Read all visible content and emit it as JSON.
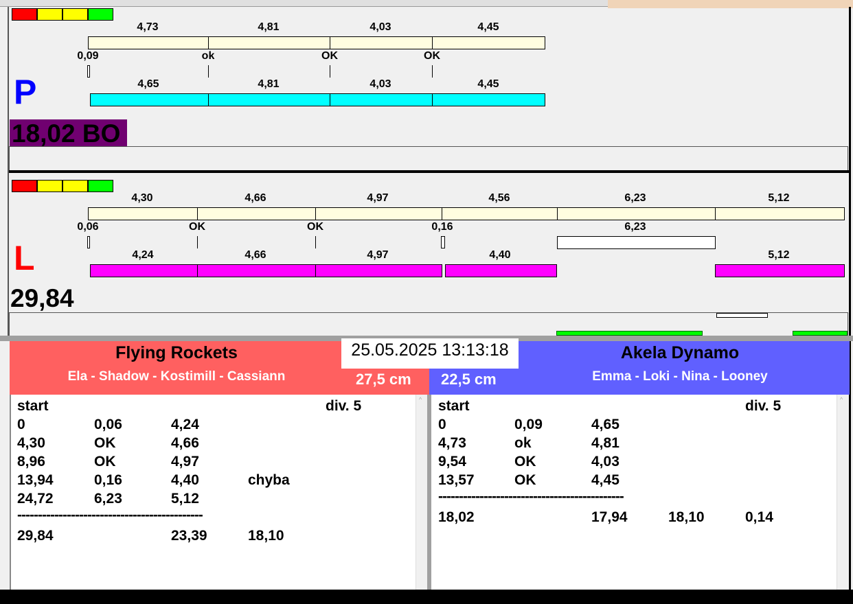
{
  "colors": {
    "red": "#ff0000",
    "yellow": "#ffff00",
    "green": "#00ff00",
    "cream": "#fffde0",
    "cyan": "#00ffff",
    "magenta": "#ff00ff",
    "purple": "#700070",
    "team_left": "#ff6060",
    "team_right": "#6060ff"
  },
  "panel_p": {
    "letter": "P",
    "top_times": [
      "4,73",
      "4,81",
      "4,03",
      "4,45"
    ],
    "marks": [
      "0,09",
      "ok",
      "OK",
      "OK"
    ],
    "bottom_times": [
      "4,65",
      "4,81",
      "4,03",
      "4,45"
    ],
    "total": "18,02 BO"
  },
  "panel_l": {
    "letter": "L",
    "top_times": [
      "4,30",
      "4,66",
      "4,97",
      "4,56",
      "6,23",
      "5,12"
    ],
    "marks": [
      "0,06",
      "OK",
      "OK",
      "0,16",
      "6,23"
    ],
    "bottom_times": [
      "4,24",
      "4,66",
      "4,97",
      "4,40",
      "5,12"
    ],
    "total": "29,84"
  },
  "datetime": "25.05.2025 13:13:18",
  "left_team": {
    "name": "Flying Rockets",
    "members": "Ela - Shadow - Kostimill - Cassiann",
    "height": "27,5 cm",
    "log": {
      "start": "start",
      "div": "div.  5",
      "rows": [
        [
          "0",
          "0,06",
          "4,24",
          ""
        ],
        [
          "4,30",
          "OK",
          "4,66",
          ""
        ],
        [
          "8,96",
          "OK",
          "4,97",
          ""
        ],
        [
          "13,94",
          "0,16",
          "4,40",
          "chyba"
        ],
        [
          "24,72",
          "6,23",
          "5,12",
          ""
        ]
      ],
      "separator": "---------------------------------------------",
      "summary": [
        "29,84",
        "",
        "23,39",
        "18,10"
      ]
    }
  },
  "right_team": {
    "name": "Akela Dynamo",
    "members": "Emma - Loki - Nina - Looney",
    "height": "22,5 cm",
    "log": {
      "start": "start",
      "div": "div.  5",
      "rows": [
        [
          "0",
          "0,09",
          "4,65"
        ],
        [
          "4,73",
          "ok",
          "4,81"
        ],
        [
          "9,54",
          "OK",
          "4,03"
        ],
        [
          "13,57",
          "OK",
          "4,45"
        ]
      ],
      "separator": "---------------------------------------------",
      "summary": [
        "18,02",
        "",
        "17,94",
        "18,10",
        "0,14"
      ]
    }
  }
}
